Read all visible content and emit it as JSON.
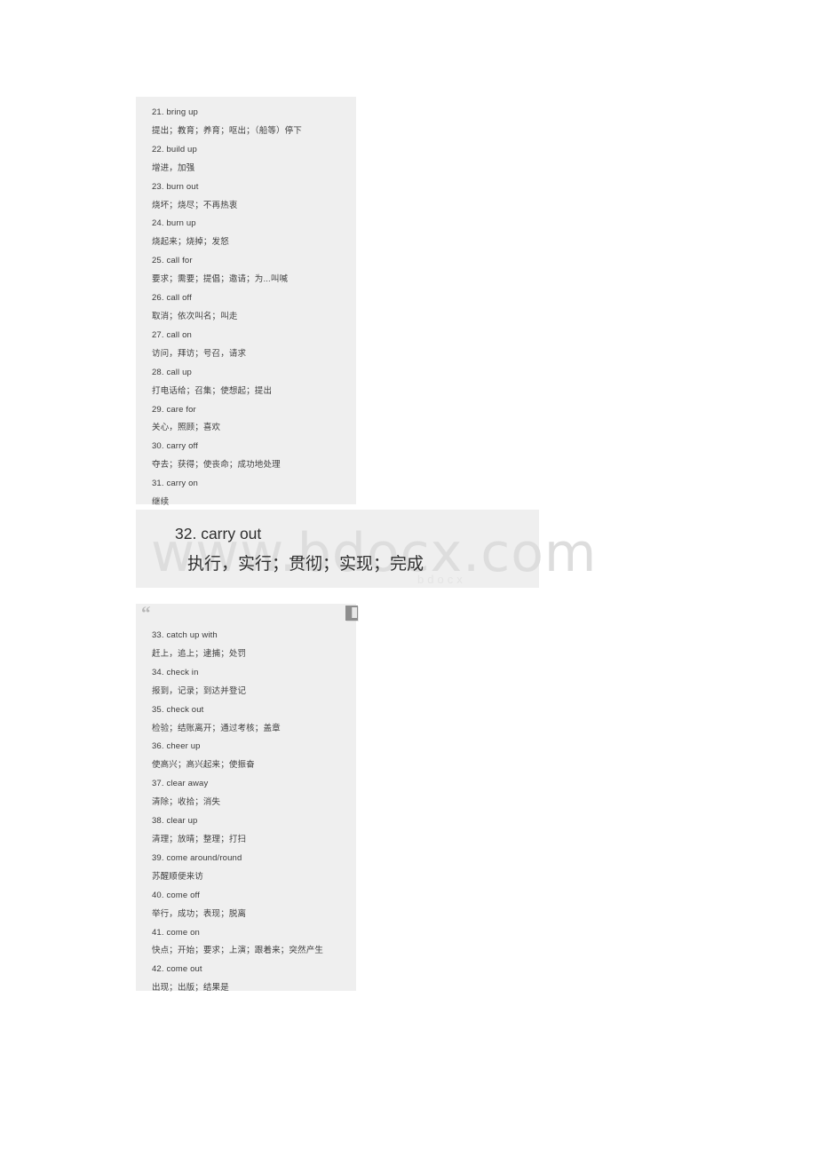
{
  "document": {
    "watermark": "www.bdocx.com",
    "watermark_sub": "bdocx",
    "background_color": "#ffffff",
    "block_color": "#efefef",
    "text_color": "#3a3a3a"
  },
  "block_one": {
    "entries": [
      {
        "term": "21. bring up",
        "definition": "提出；教育；养育；呕出；（船等）停下"
      },
      {
        "term": "22. build up",
        "definition": "增进，加强"
      },
      {
        "term": "23. burn out",
        "definition": "烧坏；烧尽；不再热衷"
      },
      {
        "term": "24. burn up",
        "definition": "烧起来；烧掉；发怒"
      },
      {
        "term": "25. call for",
        "definition": "要求；需要；提倡；邀请；为...叫喊"
      },
      {
        "term": "26. call off",
        "definition": "取消；依次叫名；叫走"
      },
      {
        "term": "27. call on",
        "definition": "访问，拜访；号召，请求"
      },
      {
        "term": "28. call up",
        "definition": "打电话给；召集；使想起；提出"
      },
      {
        "term": "29. care for",
        "definition": "关心，照顾；喜欢"
      },
      {
        "term": "30. carry off",
        "definition": "夺去；获得；使丧命；成功地处理"
      },
      {
        "term": "31. carry on",
        "definition": "继续"
      }
    ]
  },
  "block_two": {
    "term": "32. carry out",
    "definition": "执行，实行；贯彻；实现；完成"
  },
  "block_three": {
    "quote_glyph": "“",
    "entries": [
      {
        "term": "33. catch up with",
        "definition": "赶上，追上；逮捕；处罚"
      },
      {
        "term": "34. check in",
        "definition": "报到，记录；到达并登记"
      },
      {
        "term": "35. check out",
        "definition": "检验；结账离开；通过考核；盖章"
      },
      {
        "term": "36. cheer up",
        "definition": "使高兴；高兴起来；使振奋"
      },
      {
        "term": "37. clear away",
        "definition": "清除；收拾；消失"
      },
      {
        "term": "38. clear up",
        "definition": "清理；放晴；整理；打扫"
      },
      {
        "term": "39. come around/round",
        "definition": "苏醒顺便来访"
      },
      {
        "term": "40. come off",
        "definition": "举行，成功；表现；脱离"
      },
      {
        "term": "41. come on",
        "definition": "快点；开始；要求；上演；跟着来；突然产生"
      },
      {
        "term": "42. come out",
        "definition": "出现；出版；结果是"
      }
    ]
  }
}
